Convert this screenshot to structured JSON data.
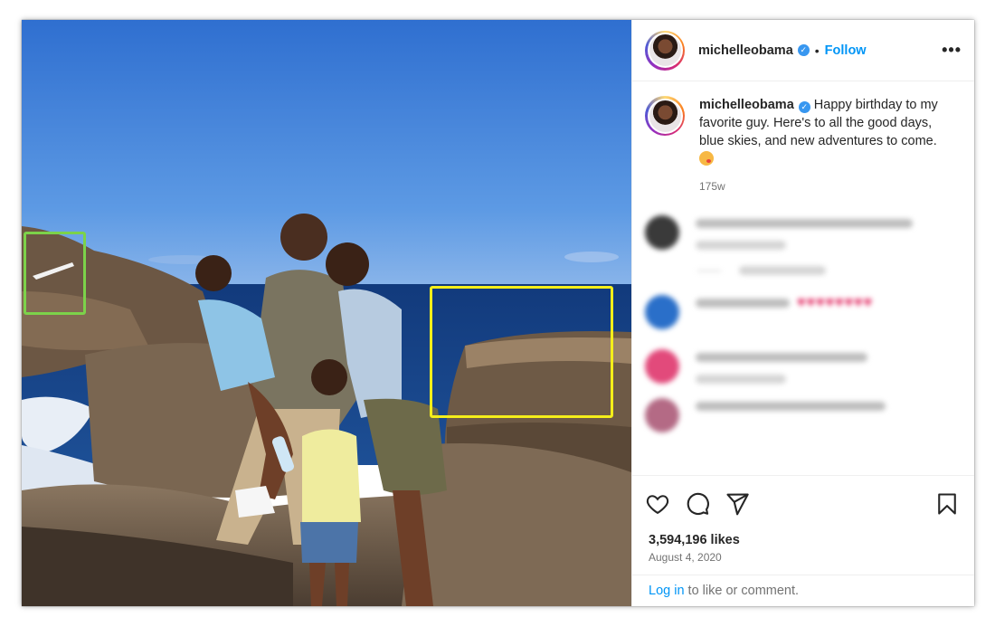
{
  "post": {
    "username": "michelleobama",
    "separator": "•",
    "follow_label": "Follow",
    "more_label": "•••"
  },
  "caption": {
    "username": "michelleobama",
    "text": "Happy birthday to my favorite guy. Here's to all the good days, blue skies, and new adventures to come.",
    "emoji": "kissing-face-emoji",
    "age": "175w"
  },
  "comments": [
    {
      "username": "reflectionfrequency",
      "text": "Spoken Island",
      "meta": "…",
      "blurred": true
    },
    {
      "username": "sexy_sues",
      "text": "♥♥♥♥♥♥♥♥",
      "meta": "…",
      "blurred": true
    },
    {
      "username": "…",
      "text": "…",
      "meta": "…",
      "blurred": true
    }
  ],
  "replies_label": "View replies",
  "hearts": "♥♥♥♥♥♥♥♥",
  "likes": "3,594,196 likes",
  "date": "August 4, 2020",
  "login": {
    "link": "Log in",
    "rest": "to like or comment."
  },
  "highlights": [
    {
      "color": "#7cd24a",
      "label": "green-highlight"
    },
    {
      "color": "#f4ee1a",
      "label": "yellow-highlight"
    }
  ],
  "colors": {
    "link": "#0095f6",
    "verified": "#3897f0",
    "muted": "#737373"
  },
  "icons": [
    "heart-icon",
    "comment-icon",
    "share-icon",
    "bookmark-icon",
    "verified-icon",
    "more-icon"
  ]
}
